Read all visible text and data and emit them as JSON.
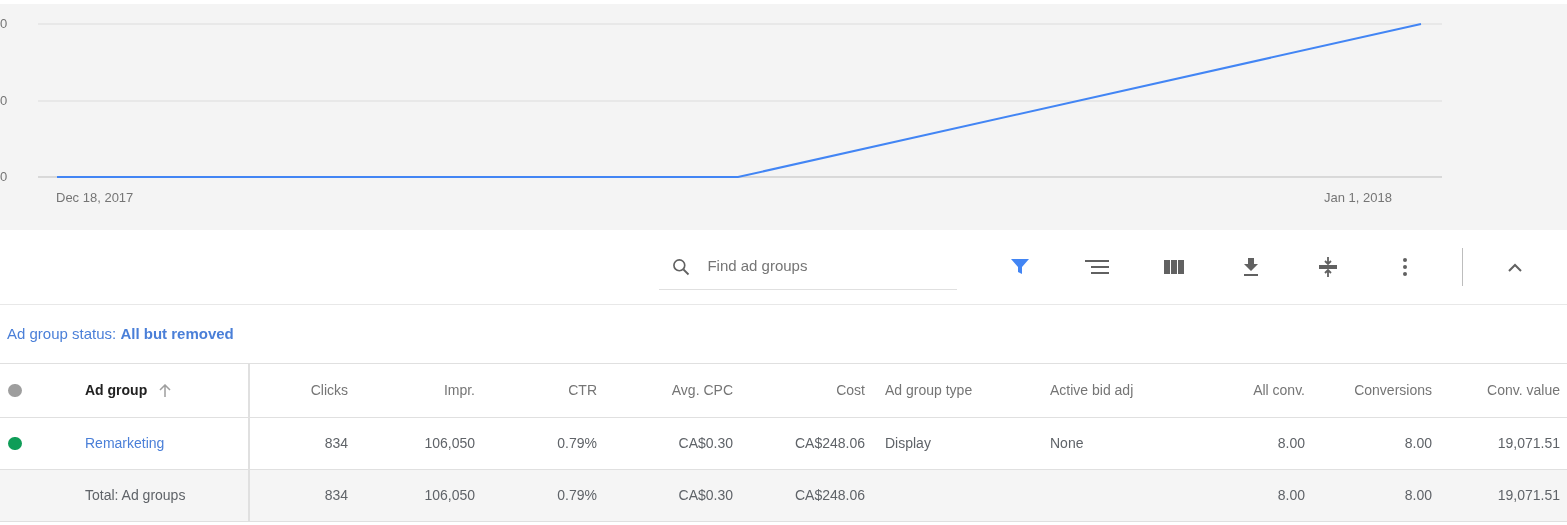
{
  "chart": {
    "y_tick_labels": [
      "0",
      "0",
      "0"
    ],
    "x_labels": [
      "Dec 18, 2017",
      "Jan 1, 2018"
    ]
  },
  "toolbar": {
    "search": {
      "placeholder": "Find ad groups"
    },
    "filter_active": true
  },
  "filter_text": "Ad group status: **All but removed**",
  "table": {
    "columns": [
      {
        "label": "Ad group",
        "kind": "text",
        "sorted": true
      },
      {
        "label": "Clicks",
        "kind": "number",
        "sorted": false
      },
      {
        "label": "Impr.",
        "kind": "number",
        "sorted": false
      },
      {
        "label": "CTR",
        "kind": "number",
        "sorted": false
      },
      {
        "label": "Avg. CPC",
        "kind": "number",
        "sorted": false
      },
      {
        "label": "Cost",
        "kind": "number",
        "sorted": false
      },
      {
        "label": "Ad group type",
        "kind": "text",
        "sorted": false
      },
      {
        "label": "Active bid adj",
        "kind": "text",
        "sorted": false
      },
      {
        "label": "All conv.",
        "kind": "number",
        "sorted": false
      },
      {
        "label": "Conversions",
        "kind": "number",
        "sorted": false
      },
      {
        "label": "Conv. value",
        "kind": "number",
        "sorted": false
      }
    ],
    "rows": [
      {
        "kind": "item",
        "color": "#0f9d58",
        "cells": [
          "Remarketing",
          "834",
          "106,050",
          "0.79%",
          "CA$0.30",
          "CA$248.06",
          "Display",
          "None",
          "8.00",
          "8.00",
          "19,071.51"
        ]
      },
      {
        "kind": "total",
        "cells": [
          "Total: Ad groups",
          "834",
          "106,050",
          "0.79%",
          "CA$0.30",
          "CA$248.06",
          "",
          "",
          "8.00",
          "8.00",
          "19,071.51"
        ]
      }
    ]
  }
}
